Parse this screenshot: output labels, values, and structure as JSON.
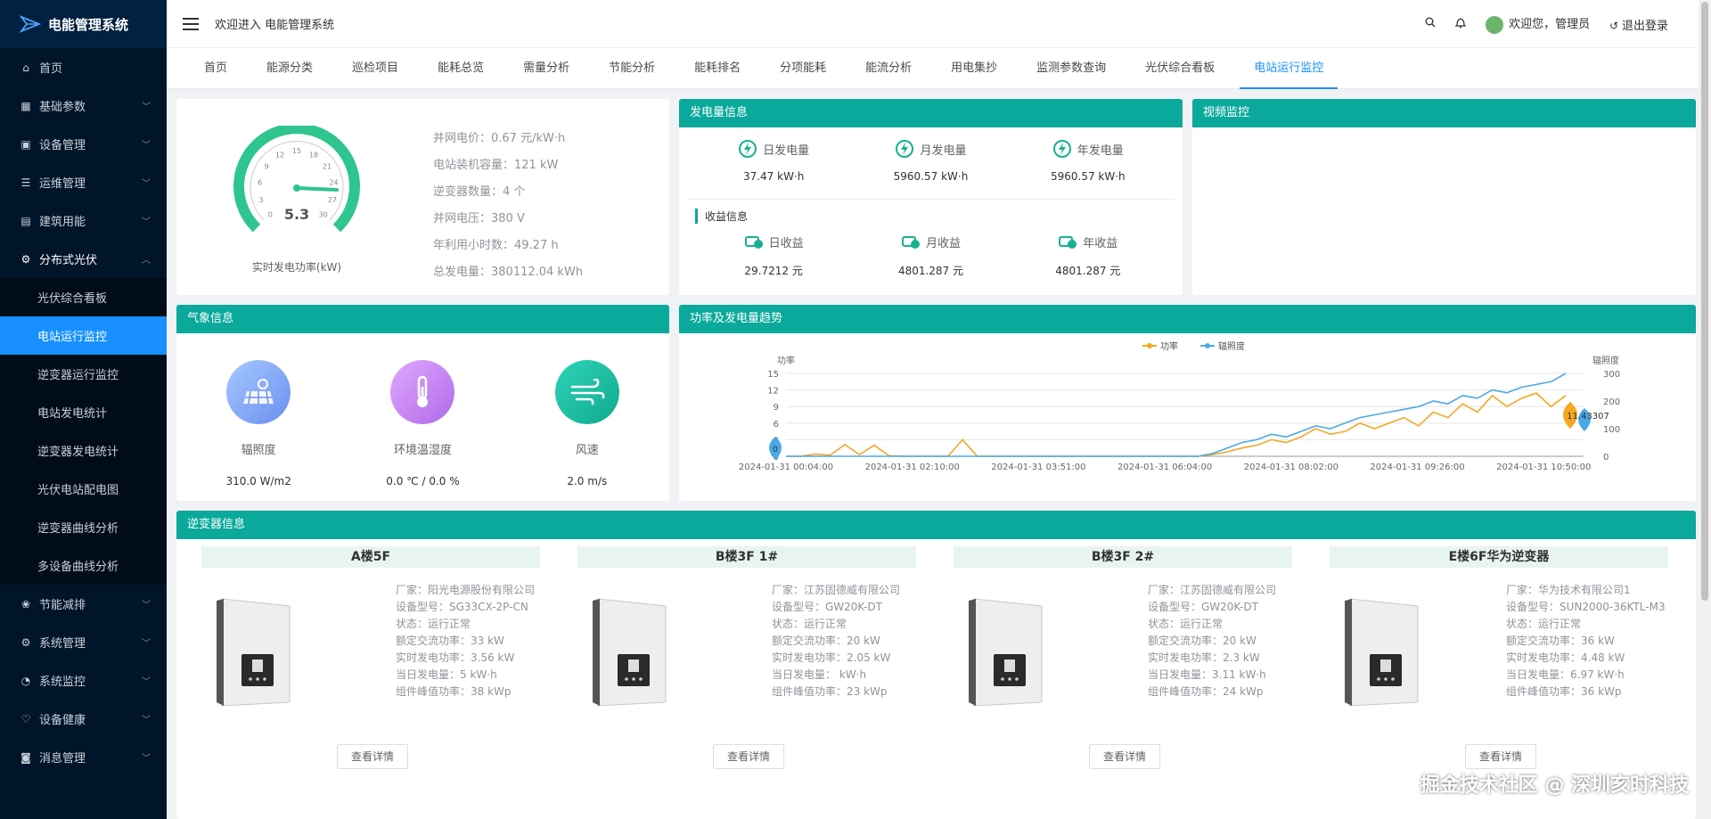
{
  "app": {
    "title": "电能管理系统"
  },
  "sidebar": {
    "items": [
      {
        "label": "首页",
        "icon": "home-icon"
      },
      {
        "label": "基础参数",
        "icon": "grid-icon"
      },
      {
        "label": "设备管理",
        "icon": "device-icon"
      },
      {
        "label": "运维管理",
        "icon": "list-icon"
      },
      {
        "label": "建筑用能",
        "icon": "building-icon"
      },
      {
        "label": "分布式光伏",
        "icon": "solar-icon"
      }
    ],
    "sub": [
      "光伏综合看板",
      "电站运行监控",
      "逆变器运行监控",
      "电站发电统计",
      "逆变器发电统计",
      "光伏电站配电图",
      "逆变器曲线分析",
      "多设备曲线分析"
    ],
    "items2": [
      {
        "label": "节能减排",
        "icon": "leaf-icon"
      },
      {
        "label": "系统管理",
        "icon": "gear-icon"
      },
      {
        "label": "系统监控",
        "icon": "monitor-icon"
      },
      {
        "label": "设备健康",
        "icon": "health-icon"
      },
      {
        "label": "消息管理",
        "icon": "message-icon"
      }
    ]
  },
  "header": {
    "welcome": "欢迎进入 电能管理系统",
    "user": "欢迎您，管理员",
    "logout": "退出登录"
  },
  "tabs": [
    "首页",
    "能源分类",
    "巡检项目",
    "能耗总览",
    "需量分析",
    "节能分析",
    "能耗排名",
    "分项能耗",
    "能流分析",
    "用电集抄",
    "监测参数查询",
    "光伏综合看板",
    "电站运行监控"
  ],
  "gauge": {
    "value": "5.3",
    "label": "实时发电功率(kW)",
    "ticks": [
      "0",
      "3",
      "6",
      "9",
      "12",
      "15",
      "18",
      "21",
      "24",
      "27",
      "30"
    ]
  },
  "station_info": [
    "并网电价：0.67 元/kW·h",
    "电站装机容量：121 kW",
    "逆变器数量：4 个",
    "并网电压：380 V",
    "年利用小时数：49.27 h",
    "总发电量：380112.04 kWh"
  ],
  "generation": {
    "title": "发电量信息",
    "items": [
      {
        "label": "日发电量",
        "value": "37.47 kW·h"
      },
      {
        "label": "月发电量",
        "value": "5960.57 kW·h"
      },
      {
        "label": "年发电量",
        "value": "5960.57 kW·h"
      }
    ],
    "income_title": "收益信息",
    "income": [
      {
        "label": "日收益",
        "value": "29.7212 元"
      },
      {
        "label": "月收益",
        "value": "4801.287 元"
      },
      {
        "label": "年收益",
        "value": "4801.287 元"
      }
    ]
  },
  "video": {
    "title": "视频监控"
  },
  "weather": {
    "title": "气象信息",
    "items": [
      {
        "label": "辐照度",
        "value": "310.0 W/m2"
      },
      {
        "label": "环境温湿度",
        "value": "0.0 ℃ / 0.0 %"
      },
      {
        "label": "风速",
        "value": "2.0 m/s"
      }
    ]
  },
  "trend": {
    "title": "功率及发电量趋势"
  },
  "chart_data": {
    "type": "line",
    "x": [
      "2024-01-31 00:04:00",
      "2024-01-31 02:10:00",
      "2024-01-31 03:51:00",
      "2024-01-31 06:04:00",
      "2024-01-31 08:02:00",
      "2024-01-31 09:26:00",
      "2024-01-31 10:50:00"
    ],
    "ylabel": "功率",
    "ylabel2": "辐照度",
    "ylim": [
      0,
      15
    ],
    "ylim2": [
      0,
      300
    ],
    "yticks": [
      "0",
      "3",
      "6",
      "9",
      "12",
      "15"
    ],
    "yticks2": [
      "0",
      "100",
      "200",
      "300"
    ],
    "series": [
      {
        "name": "功率",
        "color": "#f5a623",
        "values": [
          0,
          0,
          0.4,
          0.2,
          2.1,
          0.3,
          2,
          0.1,
          0,
          0,
          0,
          0,
          3,
          0,
          0,
          0,
          0,
          0,
          0,
          0,
          0,
          0,
          0,
          0,
          0,
          0,
          0,
          0,
          0,
          0.3,
          0.8,
          1.5,
          2,
          3,
          2.5,
          3.5,
          5,
          4,
          4.5,
          6,
          5,
          6,
          7,
          5.5,
          8,
          7,
          9.5,
          8,
          11,
          9,
          10.5,
          11.43,
          9,
          11
        ]
      },
      {
        "name": "辐照度",
        "color": "#4aa8e8",
        "values": [
          0,
          0,
          0,
          0,
          0,
          0,
          0,
          0,
          0,
          0,
          0,
          0,
          0,
          0,
          0,
          0,
          0,
          0,
          0,
          0,
          0,
          0,
          0,
          0,
          0,
          0,
          0,
          0,
          0,
          10,
          30,
          50,
          60,
          80,
          70,
          90,
          110,
          100,
          120,
          140,
          150,
          160,
          170,
          180,
          200,
          190,
          220,
          210,
          240,
          230,
          250,
          260,
          270,
          300
        ]
      }
    ],
    "markers": [
      {
        "label": "0",
        "series": "辐照度"
      },
      {
        "label": "11.43307",
        "series": "功率"
      }
    ]
  },
  "inverter": {
    "title": "逆变器信息",
    "detail_label": "查看详情",
    "units": [
      {
        "name": "A楼5F",
        "info": [
          "厂家：阳光电源股份有限公司",
          "设备型号：SG33CX-2P-CN",
          "状态：运行正常",
          "额定交流功率：33 kW",
          "实时发电功率：3.56 kW",
          "当日发电量：5 kW·h",
          "组件峰值功率：38 kWp"
        ]
      },
      {
        "name": "B楼3F 1#",
        "info": [
          "厂家：江苏固德威有限公司",
          "设备型号：GW20K-DT",
          "状态：运行正常",
          "额定交流功率：20 kW",
          "实时发电功率：2.05 kW",
          "当日发电量： kW·h",
          "组件峰值功率：23 kWp"
        ]
      },
      {
        "name": "B楼3F 2#",
        "info": [
          "厂家：江苏固德威有限公司",
          "设备型号：GW20K-DT",
          "状态：运行正常",
          "额定交流功率：20 kW",
          "实时发电功率：2.3 kW",
          "当日发电量：3.11 kW·h",
          "组件峰值功率：24 kWp"
        ]
      },
      {
        "name": "E楼6F华为逆变器",
        "info": [
          "厂家：华为技术有限公司1",
          "设备型号：SUN2000-36KTL-M3",
          "状态：运行正常",
          "额定交流功率：36 kW",
          "实时发电功率：4.48 kW",
          "当日发电量：6.97 kW·h",
          "组件峰值功率：36 kWp"
        ]
      }
    ]
  },
  "watermark": "掘金技术社区 @ 深圳亥时科技"
}
